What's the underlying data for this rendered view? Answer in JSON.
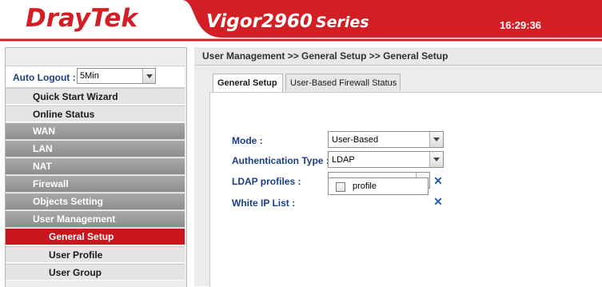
{
  "header": {
    "logo": "DrayTek",
    "product": "Vigor2960",
    "series": "Series",
    "clock": "16:29:36",
    "brand_color": "#d21f25"
  },
  "sidebar": {
    "auto_logout_label": "Auto Logout :",
    "auto_logout_value": "5Min",
    "items": [
      {
        "label": "Quick Start Wizard"
      },
      {
        "label": "Online Status"
      },
      {
        "label": "WAN"
      },
      {
        "label": "LAN"
      },
      {
        "label": "NAT"
      },
      {
        "label": "Firewall"
      },
      {
        "label": "Objects Setting"
      },
      {
        "label": "User Management"
      },
      {
        "label": "General Setup"
      },
      {
        "label": "User Profile"
      },
      {
        "label": "User Group"
      }
    ]
  },
  "main": {
    "breadcrumb": "User Management >> General Setup >> General Setup",
    "tabs": [
      {
        "label": "General Setup"
      },
      {
        "label": "User-Based Firewall Status"
      }
    ],
    "form": {
      "mode_label": "Mode :",
      "mode_value": "User-Based",
      "auth_label": "Authentication Type :",
      "auth_value": "LDAP",
      "ldap_label": "LDAP profiles :",
      "ldap_value": "",
      "white_ip_label": "White IP List :",
      "ldap_option": "profile"
    }
  }
}
